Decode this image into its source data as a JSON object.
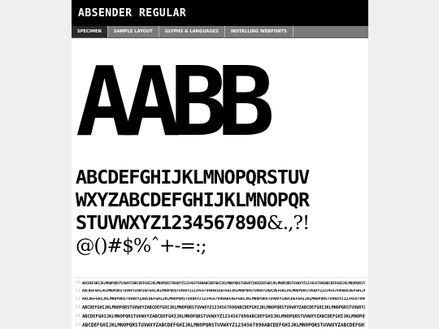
{
  "header": {
    "title": "ABSENDER REGULAR"
  },
  "tabs": [
    {
      "label": "SPECIMEN"
    },
    {
      "label": "SAMPLE LAYOUT"
    },
    {
      "label": "GLYPHS & LANGUAGES"
    },
    {
      "label": "INSTALLING WEBFONTS"
    }
  ],
  "specimen": {
    "big_sample": "AABB",
    "charset_lines": [
      "ABCDEFGHIJKLMNOPQRSTUV",
      "WXYZABCDEFGHIJKLMNOPQR",
      "STUVWXYZ1234567890",
      "@()#$%ˆ+-=:;"
    ],
    "charset_line3_symbols": "&.,?!",
    "waterfall": [
      {
        "size": "10",
        "text": "ABCDEFGHIJKLMNOPQRSTUVWXYZABCDEFGHIJKLMNOPQRSTUVWXYZ1234567890ABCDEFGHIJKLMNOPQRSTUVWXYZABCDEFGHIJKLMNOPQRSTUVWXYZ1234567890ABCDEFGHIJKLMNOPQRSTUVWXYZ"
      },
      {
        "size": "11",
        "text": "ABCDEFGHIJKLMNOPQRSTUVWXYZABCDEFGHIJKLMNOPQRSTUVWXYZ1234567890ABCDEFGHIJKLMNOPQRSTUVWXYZABCDEFGHIJKLMNOPQRSTUVWXYZ1234567890ABCDEFGHIJKL"
      },
      {
        "size": "12",
        "text": "ABCDEFGHIJKLMNOPQRSTUVWXYZABCDEFGHIJKLMNOPQRSTUVWXYZ1234567890ABCDEFGHIJKLMNOPQRSTUVWXYZABCDEFGHIJKLMNOPQRSTUVWXYZ1234567890ABCDEF"
      },
      {
        "size": "13",
        "text": "ABCDEFGHIJKLMNOPQRSTUVWXYZABCDEFGHIJKLMNOPQRSTUVWXYZ1234567890ABCDEFGHIJKLMNOPQRSTUVWXYZABCDEFGHIJKLMNOPQRSTUVWXYZ1234567890"
      },
      {
        "size": "14",
        "text": "ABCDEFGHIJKLMNOPQRSTUVWXYZABCDEFGHIJKLMNOPQRSTUVWXYZ1234567890ABCDEFGHIJKLMNOPQRSTUVWXYZABCDEFGHIJKLMNOPQRSTUVWXYZ"
      },
      {
        "size": "15",
        "text": "ABCDEFGHIJKLMNOPQRSTUVWXYZABCDEFGHIJKLMNOPQRSTUVWXYZ1234567890ABCDEFGHIJKLMNOPQRSTUVWXYZABCDEFGHIJKL"
      }
    ]
  }
}
